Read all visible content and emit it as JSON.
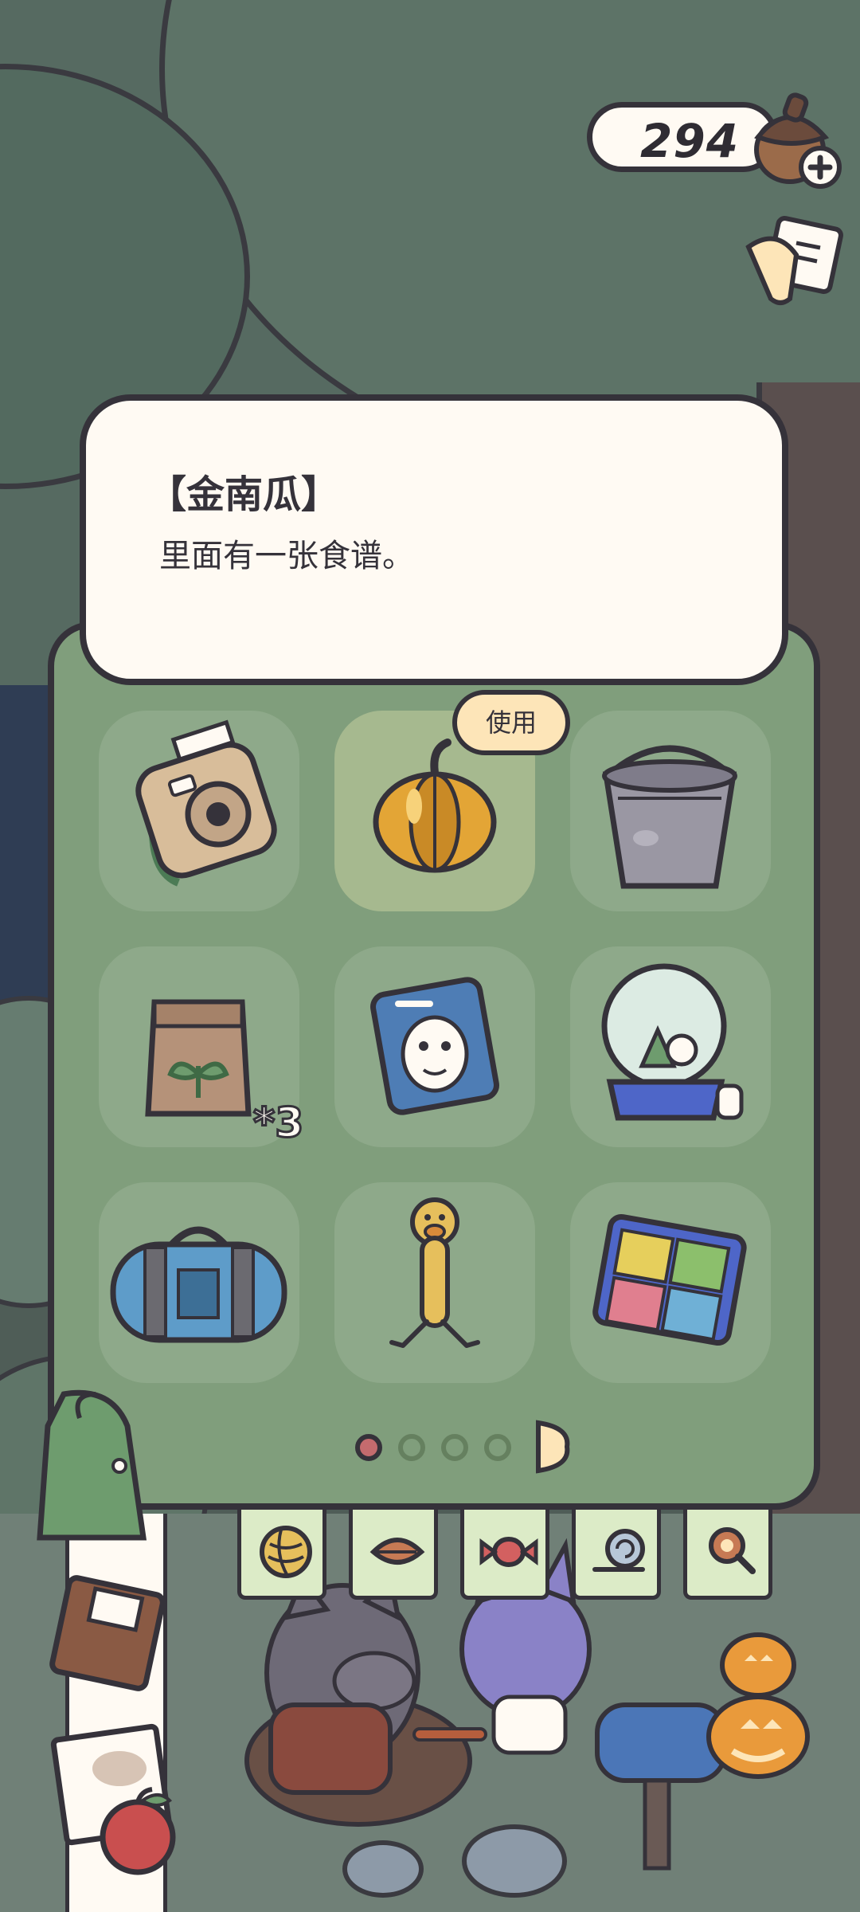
{
  "currency": {
    "amount": "294",
    "icon": "acorn-icon"
  },
  "item_detail": {
    "title": "【金南瓜】",
    "description": "里面有一张食谱。"
  },
  "actions": {
    "use_label": "使用"
  },
  "inventory": {
    "items": [
      {
        "name": "camera",
        "icon": "instant-camera-icon",
        "count": ""
      },
      {
        "name": "golden-pumpkin",
        "icon": "golden-pumpkin-icon",
        "count": "",
        "selected": true
      },
      {
        "name": "bucket",
        "icon": "metal-bucket-icon",
        "count": ""
      },
      {
        "name": "seed-bag",
        "icon": "seed-bag-icon",
        "count": "*3"
      },
      {
        "name": "face-mask",
        "icon": "face-mask-pack-icon",
        "count": ""
      },
      {
        "name": "snow-globe",
        "icon": "snow-globe-icon",
        "count": ""
      },
      {
        "name": "duffel-bag",
        "icon": "duffel-bag-icon",
        "count": ""
      },
      {
        "name": "rubber-duck",
        "icon": "rubber-chicken-toy-icon",
        "count": ""
      },
      {
        "name": "puzzle-box",
        "icon": "puzzle-box-icon",
        "count": ""
      }
    ],
    "pagination": {
      "current_page": 1,
      "total_pages": 4
    }
  },
  "categories": [
    {
      "name": "yarn",
      "icon": "yarn-ball-icon"
    },
    {
      "name": "leaf",
      "icon": "leaf-icon"
    },
    {
      "name": "candy",
      "icon": "candy-icon"
    },
    {
      "name": "snail",
      "icon": "snail-icon"
    },
    {
      "name": "search",
      "icon": "magnifier-icon"
    }
  ],
  "colors": {
    "panel": "#809e7c",
    "slot": "#8ea98a",
    "slot_selected": "#a6b98f",
    "card": "#fffaf3",
    "outline": "#35323a",
    "page_dot_active": "#c46b6e",
    "use_button": "#fde5b8"
  }
}
